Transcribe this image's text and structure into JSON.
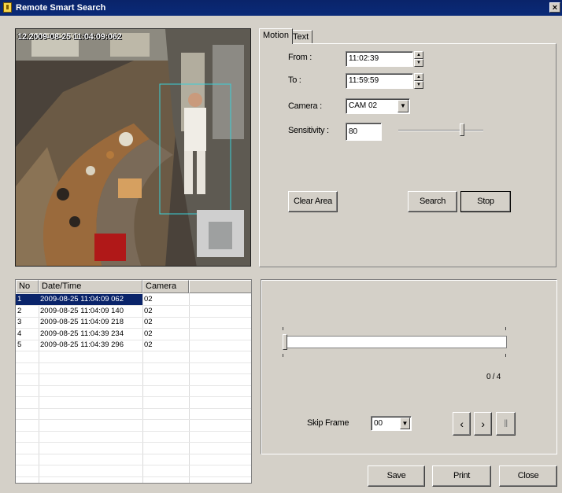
{
  "window": {
    "title": "Remote Smart Search",
    "close_glyph": "×"
  },
  "video": {
    "osd": "12.2009-08-25 11:04:09:062"
  },
  "tabs": [
    {
      "label": "Motion"
    },
    {
      "label": "Text"
    }
  ],
  "motion": {
    "from_label": "From :",
    "from_value": "11:02:39",
    "to_label": "To :",
    "to_value": "11:59:59",
    "camera_label": "Camera :",
    "camera_value": "CAM 02",
    "sensitivity_label": "Sensitivity :",
    "sensitivity_value": "80",
    "sensitivity_level": 0.75,
    "clear_area_label": "Clear Area",
    "search_label": "Search",
    "stop_label": "Stop"
  },
  "results": {
    "columns": [
      "No",
      "Date/Time",
      "Camera"
    ],
    "rows": [
      {
        "no": "1",
        "datetime": "2009-08-25 11:04:09 062",
        "camera": "02",
        "selected": true
      },
      {
        "no": "2",
        "datetime": "2009-08-25 11:04:09 140",
        "camera": "02"
      },
      {
        "no": "3",
        "datetime": "2009-08-25 11:04:09 218",
        "camera": "02"
      },
      {
        "no": "4",
        "datetime": "2009-08-25 11:04:39 234",
        "camera": "02"
      },
      {
        "no": "5",
        "datetime": "2009-08-25 11:04:39 296",
        "camera": "02"
      }
    ]
  },
  "playback": {
    "position_text": "0 / 4",
    "position_fraction": 0,
    "skip_frame_label": "Skip Frame",
    "skip_frame_value": "00",
    "prev_glyph": "‹",
    "next_glyph": "›",
    "pause_glyph": "‖"
  },
  "footer": {
    "save_label": "Save",
    "print_label": "Print",
    "close_label": "Close"
  }
}
